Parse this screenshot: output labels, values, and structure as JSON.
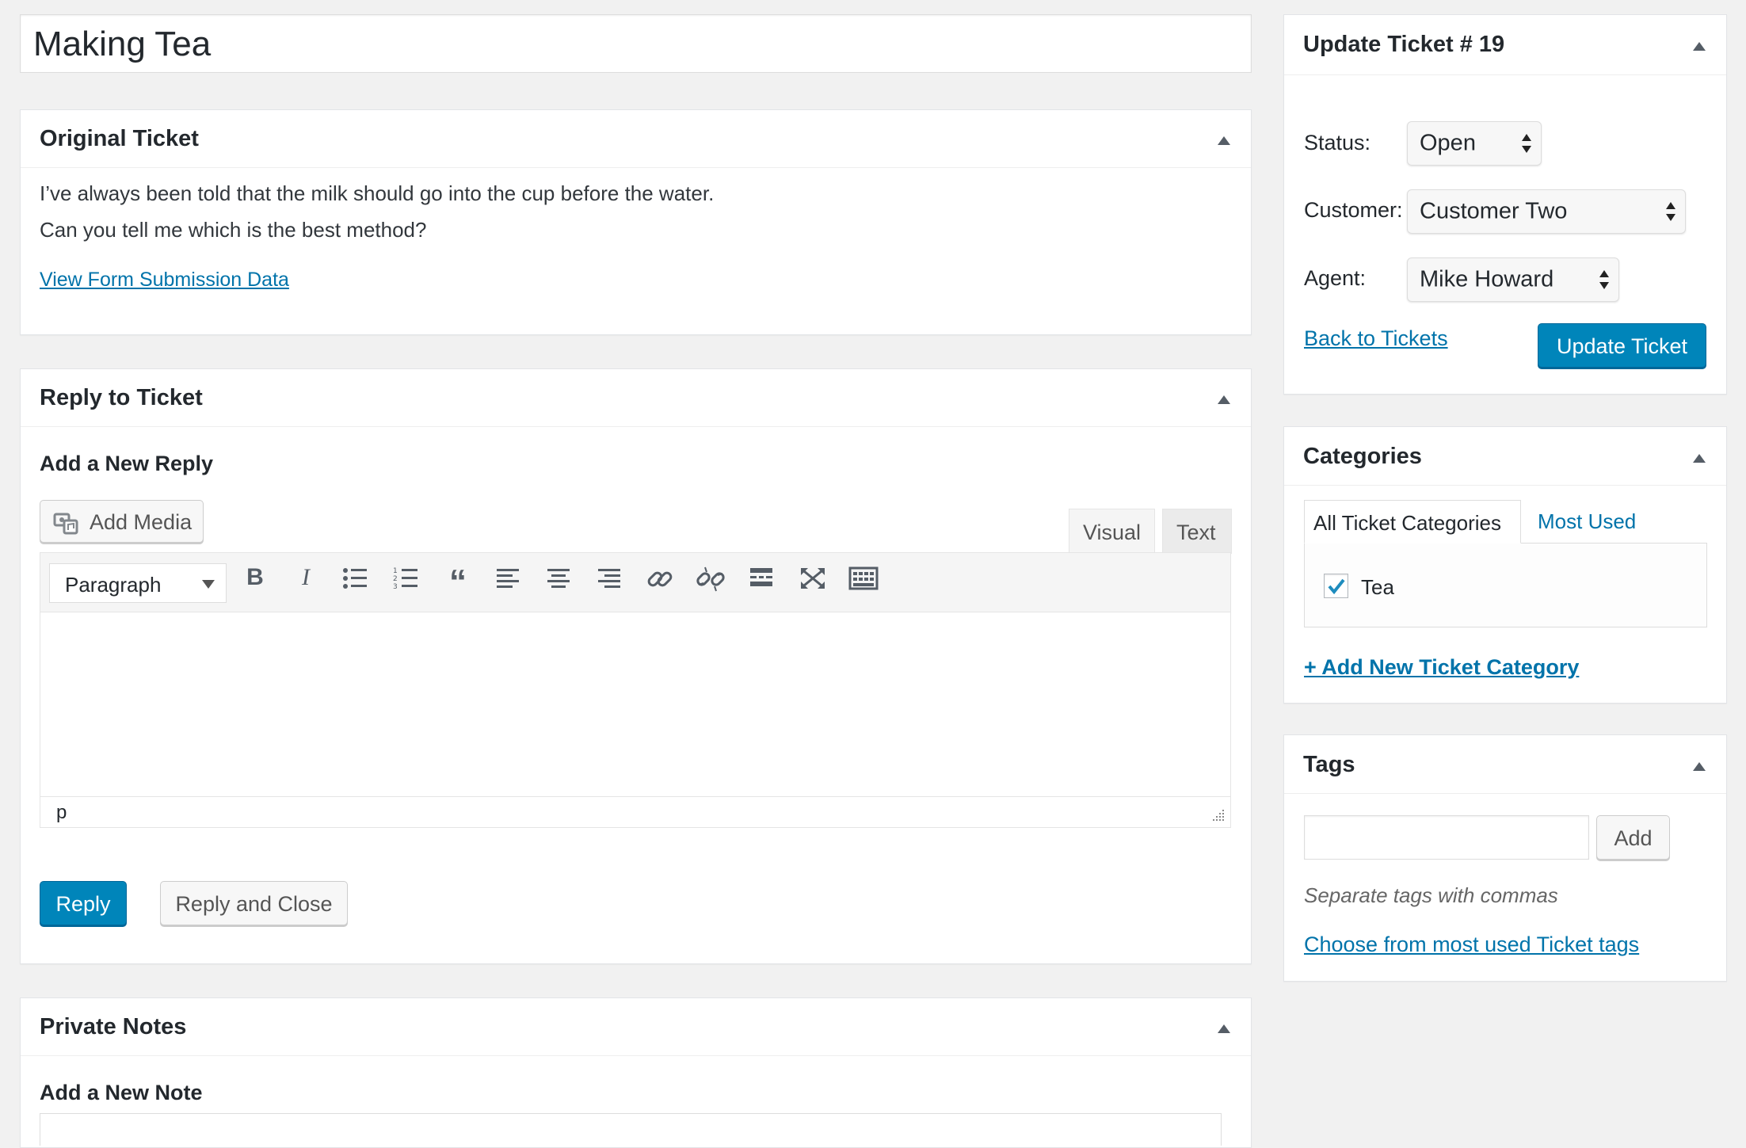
{
  "post": {
    "title": "Making Tea"
  },
  "original_ticket": {
    "title": "Original Ticket",
    "line1": "I’ve always been told that the milk should go into the cup before the water.",
    "line2": "Can you tell me which is the best method?",
    "view_link": "View Form Submission Data"
  },
  "reply": {
    "title": "Reply to Ticket",
    "subtitle": "Add a New Reply",
    "add_media": "Add Media",
    "tab_visual": "Visual",
    "tab_text": "Text",
    "format_select": "Paragraph",
    "path": "p",
    "reply_button": "Reply",
    "reply_close_button": "Reply and Close",
    "toolbar_icons": [
      "bold-icon",
      "italic-icon",
      "bullet-list-icon",
      "numbered-list-icon",
      "blockquote-icon",
      "align-left-icon",
      "align-center-icon",
      "align-right-icon",
      "link-icon",
      "unlink-icon",
      "read-more-icon",
      "fullscreen-icon",
      "toolbar-toggle-icon"
    ]
  },
  "private_notes": {
    "title": "Private Notes",
    "subtitle": "Add a New Note"
  },
  "update": {
    "title": "Update Ticket # 19",
    "status_label": "Status:",
    "status_value": "Open",
    "customer_label": "Customer:",
    "customer_value": "Customer Two",
    "agent_label": "Agent:",
    "agent_value": "Mike Howard",
    "back_link": "Back to Tickets",
    "update_button": "Update Ticket"
  },
  "categories": {
    "title": "Categories",
    "tab_all": "All Ticket Categories",
    "tab_most_used": "Most Used",
    "items": [
      {
        "label": "Tea",
        "checked": true
      }
    ],
    "add_link": "+ Add New Ticket Category"
  },
  "tags": {
    "title": "Tags",
    "add_button": "Add",
    "help": "Separate tags with commas",
    "choose_link": "Choose from most used Ticket tags"
  },
  "colors": {
    "accent": "#0085ba",
    "link": "#0073aa",
    "background": "#f1f1f1"
  }
}
